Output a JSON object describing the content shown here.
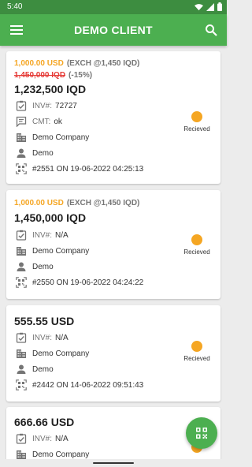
{
  "status_bar": {
    "time": "5:40"
  },
  "app_bar": {
    "title": "DEMO CLIENT"
  },
  "colors": {
    "primary": "#4caf50",
    "accent": "#f5a623",
    "strike": "#e53935"
  },
  "cards": [
    {
      "usd": "1,000.00 USD",
      "exch": "(EXCH @1,450 IQD)",
      "original": "1,450,000 IQD",
      "discount": "(-15%)",
      "amount": "1,232,500 IQD",
      "inv_label": "INV#:",
      "inv": "72727",
      "cmt_label": "CMT:",
      "cmt": "ok",
      "company": "Demo Company",
      "user": "Demo",
      "ref": "#2551 ON 19-06-2022 04:25:13",
      "status": "Recieved"
    },
    {
      "usd": "1,000.00 USD",
      "exch": "(EXCH @1,450 IQD)",
      "amount": "1,450,000 IQD",
      "inv_label": "INV#:",
      "inv": "N/A",
      "company": "Demo Company",
      "user": "Demo",
      "ref": "#2550 ON 19-06-2022 04:24:22",
      "status": "Recieved"
    },
    {
      "amount": "555.55 USD",
      "inv_label": "INV#:",
      "inv": "N/A",
      "company": "Demo Company",
      "user": "Demo",
      "ref": "#2442 ON 14-06-2022 09:51:43",
      "status": "Recieved"
    },
    {
      "amount": "666.66 USD",
      "inv_label": "INV#:",
      "inv": "N/A",
      "company": "Demo Company"
    }
  ]
}
